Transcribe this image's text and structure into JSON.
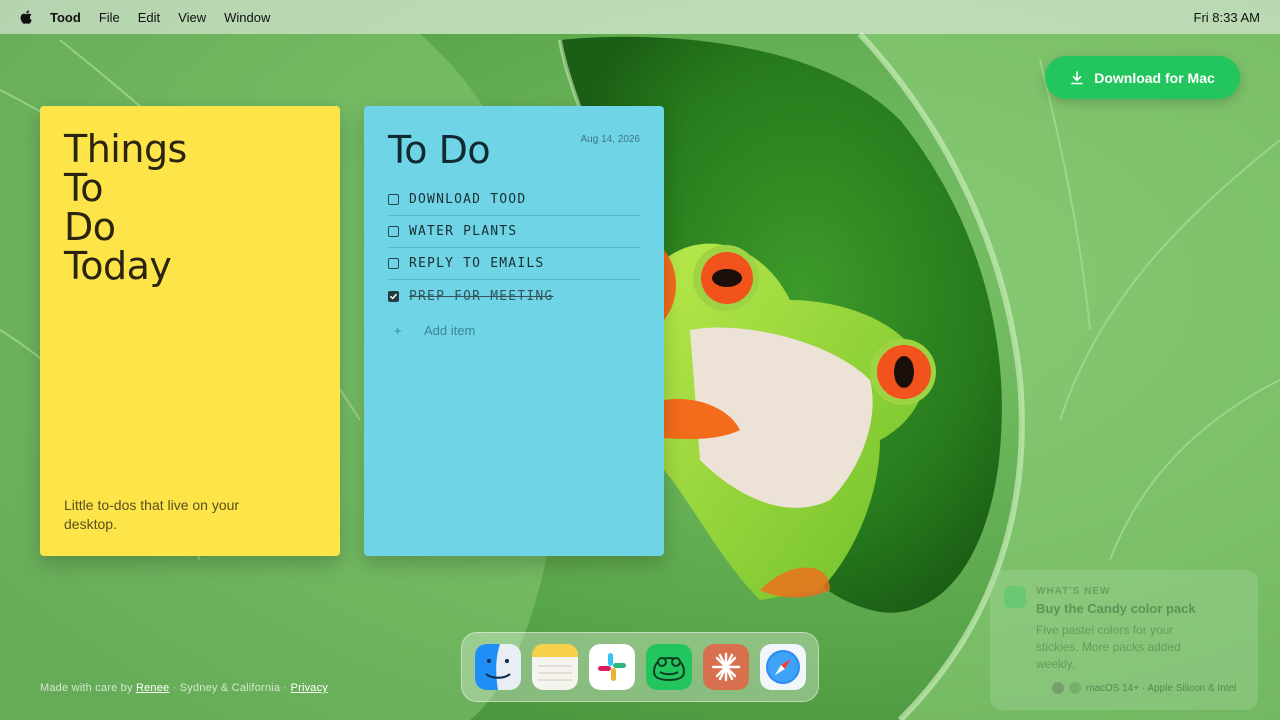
{
  "menubar": {
    "app_name": "Tood",
    "menus": [
      "File",
      "Edit",
      "View",
      "Window"
    ],
    "clock": "Fri 8:33 AM"
  },
  "download_button": {
    "label": "Download for Mac"
  },
  "yellow_note": {
    "title_lines": [
      "Things",
      "To",
      "Do",
      "Today"
    ],
    "tagline": "Little to-dos that live on your desktop."
  },
  "blue_note": {
    "title": "To Do",
    "date": "Aug 14, 2026",
    "items": [
      {
        "label": "Download Tood",
        "checked": false
      },
      {
        "label": "Water plants",
        "checked": false
      },
      {
        "label": "Reply to emails",
        "checked": false
      },
      {
        "label": "Prep for meeting",
        "checked": true
      }
    ],
    "add_item_placeholder": "Add item"
  },
  "footer": {
    "made_with": "Made with care by",
    "author": "Renee",
    "location": "· Sydney & California ·",
    "privacy": "Privacy"
  },
  "dock": {
    "icons": [
      "finder-icon",
      "notes-icon",
      "slack-icon",
      "tood-frog-icon",
      "claude-icon",
      "safari-icon"
    ]
  },
  "toast": {
    "eyebrow": "WHAT'S NEW",
    "headline": "Buy the Candy color pack",
    "body": "Five pastel colors for your stickies. More packs added weekly.",
    "meta": "macOS 14+ · Apple Silicon & Intel"
  },
  "colors": {
    "yellow_note": "#fde549",
    "blue_note": "#6fd5e6",
    "download_button": "#22c55e"
  }
}
